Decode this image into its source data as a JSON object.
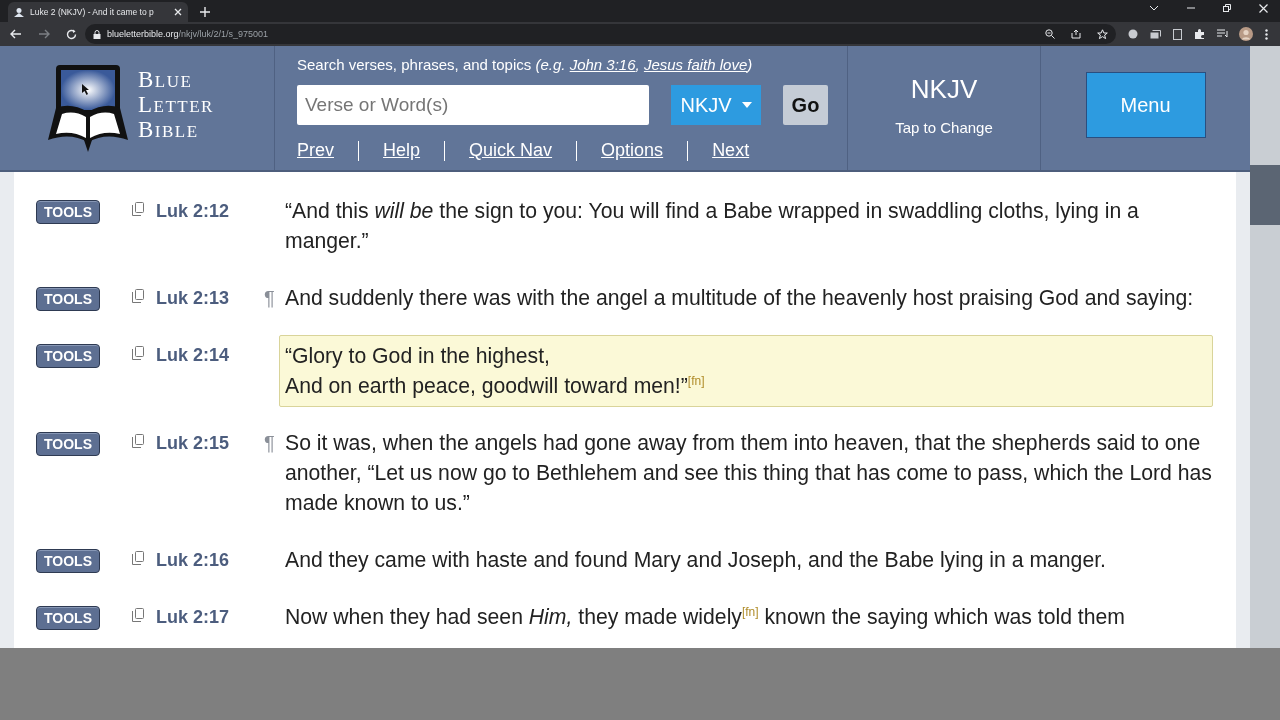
{
  "browser": {
    "tab_title": "Luke 2 (NKJV) - And it came to p",
    "url_domain": "blueletterbible.org",
    "url_path": "/nkjv/luk/2/1/s_975001"
  },
  "header": {
    "logo_lines": [
      "BLUE",
      "LETTER",
      "BIBLE"
    ],
    "search": {
      "hint": "Search verses, phrases, and topics",
      "example_open": "(e.g.",
      "examples": [
        "John 3:16",
        "Jesus faith love"
      ],
      "example_separator": ",",
      "example_close": ")",
      "placeholder": "Verse or Word(s)",
      "version": "NKJV",
      "go": "Go"
    },
    "nav_links": [
      "Prev",
      "Help",
      "Quick Nav",
      "Options",
      "Next"
    ],
    "version_panel": {
      "name": "NKJV",
      "hint": "Tap to Change"
    },
    "menu": "Menu"
  },
  "verses": [
    {
      "tools": "TOOLS",
      "ref": "Luk 2:12",
      "highlighted": false,
      "lines": [
        "“And this *will be* the sign to you: You will find a Babe wrapped in swaddling cloths, lying in a manger.”"
      ]
    },
    {
      "tools": "TOOLS",
      "ref": "Luk 2:13",
      "mark": "¶",
      "highlighted": false,
      "lines": [
        "And suddenly there was with the angel a multitude of the heavenly host praising God and saying:"
      ]
    },
    {
      "tools": "TOOLS",
      "ref": "Luk 2:14",
      "highlighted": true,
      "lines": [
        "“Glory to God in the highest,",
        "And on earth peace, goodwill toward men!”$^{[fn]}$"
      ]
    },
    {
      "tools": "TOOLS",
      "ref": "Luk 2:15",
      "mark": "¶",
      "highlighted": false,
      "lines": [
        "So it was, when the angels had gone away from them into heaven, that the shepherds said to one another, “Let us now go to Bethlehem and see this thing that has come to pass, which the Lord has made known to us.”"
      ]
    },
    {
      "tools": "TOOLS",
      "ref": "Luk 2:16",
      "highlighted": false,
      "lines": [
        "And they came with haste and found Mary and Joseph, and the Babe lying in a manger."
      ]
    },
    {
      "tools": "TOOLS",
      "ref": "Luk 2:17",
      "highlighted": false,
      "lines": [
        "Now when they had seen *Him,* they made widely$^{[fn]}$ known the saying which was told them"
      ]
    }
  ]
}
